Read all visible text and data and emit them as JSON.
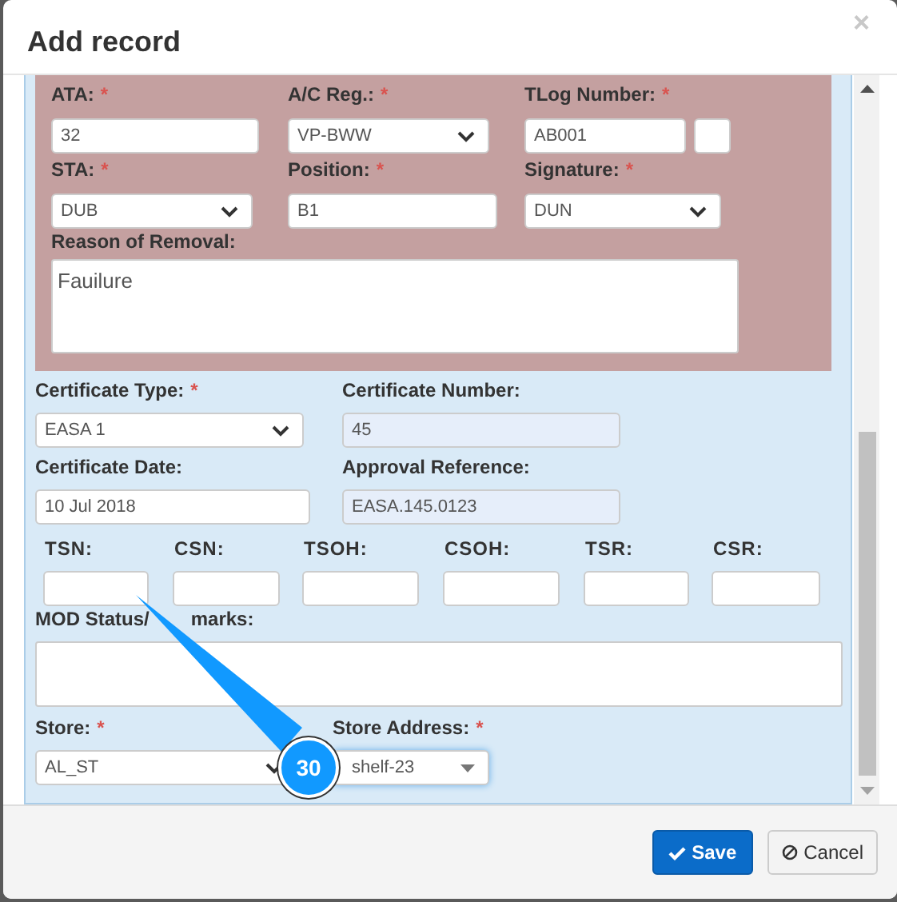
{
  "modal": {
    "title": "Add record",
    "close": "×"
  },
  "removal_section": {
    "rows": [
      [
        {
          "label": "ATA:",
          "required_mark": "*",
          "kind": "input",
          "value": "32"
        },
        {
          "label": "A/C Reg.:",
          "required_mark": "*",
          "kind": "select",
          "value": "VP-BWW"
        },
        {
          "label": "TLog Number:",
          "required_mark": "*",
          "kind": "input",
          "value": "AB001",
          "extra_box": true
        }
      ],
      [
        {
          "label": "STA:",
          "required_mark": "*",
          "kind": "select",
          "value": "DUB"
        },
        {
          "label": "Position:",
          "required_mark": "*",
          "kind": "input",
          "value": "B1"
        },
        {
          "label": "Signature:",
          "required_mark": "*",
          "kind": "select",
          "value": "DUN"
        }
      ]
    ],
    "reason": {
      "label": "Reason of Removal:",
      "value": "Fauilure"
    }
  },
  "certificate_rows": [
    [
      {
        "label": "Certificate Type:",
        "required_mark": "*",
        "kind": "select",
        "value": "EASA 1"
      },
      {
        "label": "Certificate Number:",
        "kind": "readonly",
        "value": "45"
      }
    ],
    [
      {
        "label": "Certificate Date:",
        "kind": "input",
        "value": "10 Jul 2018"
      },
      {
        "label": "Approval Reference:",
        "kind": "readonly",
        "value": "EASA.145.0123"
      }
    ]
  ],
  "counters": [
    {
      "label": "TSN:"
    },
    {
      "label": "CSN:"
    },
    {
      "label": "TSOH:"
    },
    {
      "label": "CSOH:"
    },
    {
      "label": "TSR:"
    },
    {
      "label": "CSR:"
    }
  ],
  "remarks": {
    "label_parts": [
      "MOD Status/",
      "marks:"
    ]
  },
  "store_row": [
    {
      "label": "Store:",
      "required_mark": "*",
      "kind": "select",
      "value": "AL_ST"
    },
    {
      "label": "Store Address:",
      "required_mark": "*",
      "kind": "combo",
      "value": "shelf-23"
    }
  ],
  "buttons": [
    {
      "label": "Save",
      "kind": "primary"
    },
    {
      "label": "Cancel",
      "kind": "default"
    }
  ],
  "callout": {
    "label": "30"
  }
}
